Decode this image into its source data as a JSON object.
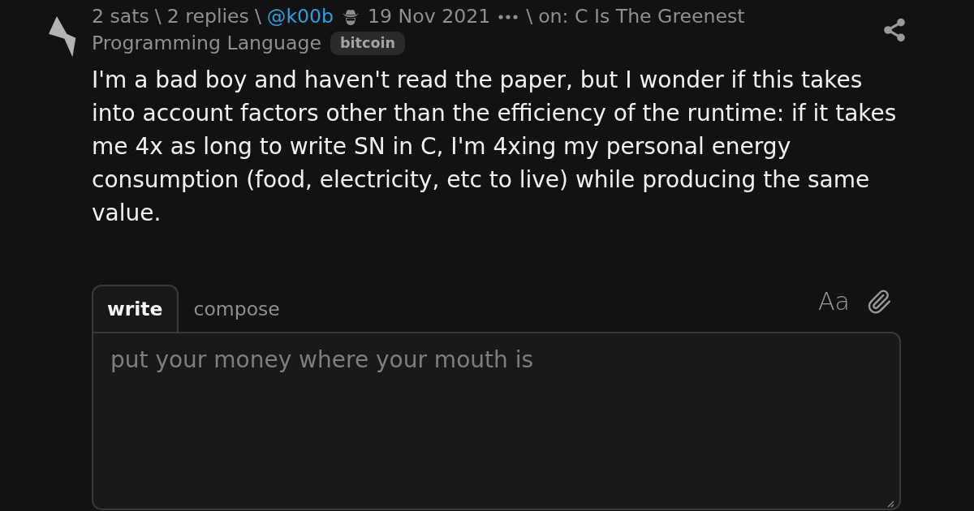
{
  "post": {
    "meta": [
      {
        "kind": "text",
        "text": "2 sats"
      },
      {
        "kind": "separator",
        "text": "\\"
      },
      {
        "kind": "link",
        "text": "2 replies"
      },
      {
        "kind": "separator",
        "text": "\\"
      },
      {
        "kind": "author",
        "text": "@k00b"
      },
      {
        "kind": "date",
        "text": "19 Nov 2021"
      },
      {
        "kind": "separator",
        "text": "\\"
      },
      {
        "kind": "link",
        "text": "on: C Is The Greenest"
      },
      {
        "kind": "link",
        "text": "Programming Language"
      },
      {
        "kind": "tag",
        "text": "bitcoin"
      }
    ],
    "body": "I'm a bad boy and haven't read the paper, but I wonder if this takes into account factors other than the efficiency of the runtime: if it takes me 4x as long to write SN in C, I'm 4xing my personal energy consumption (food, electricity, etc to live) while producing the same value."
  },
  "reply_form": {
    "tabs": [
      {
        "label": "write",
        "selected": true
      },
      {
        "label": "compose",
        "selected": false
      }
    ],
    "format_button": "Aa",
    "placeholder": "put your money where your mouth is"
  }
}
